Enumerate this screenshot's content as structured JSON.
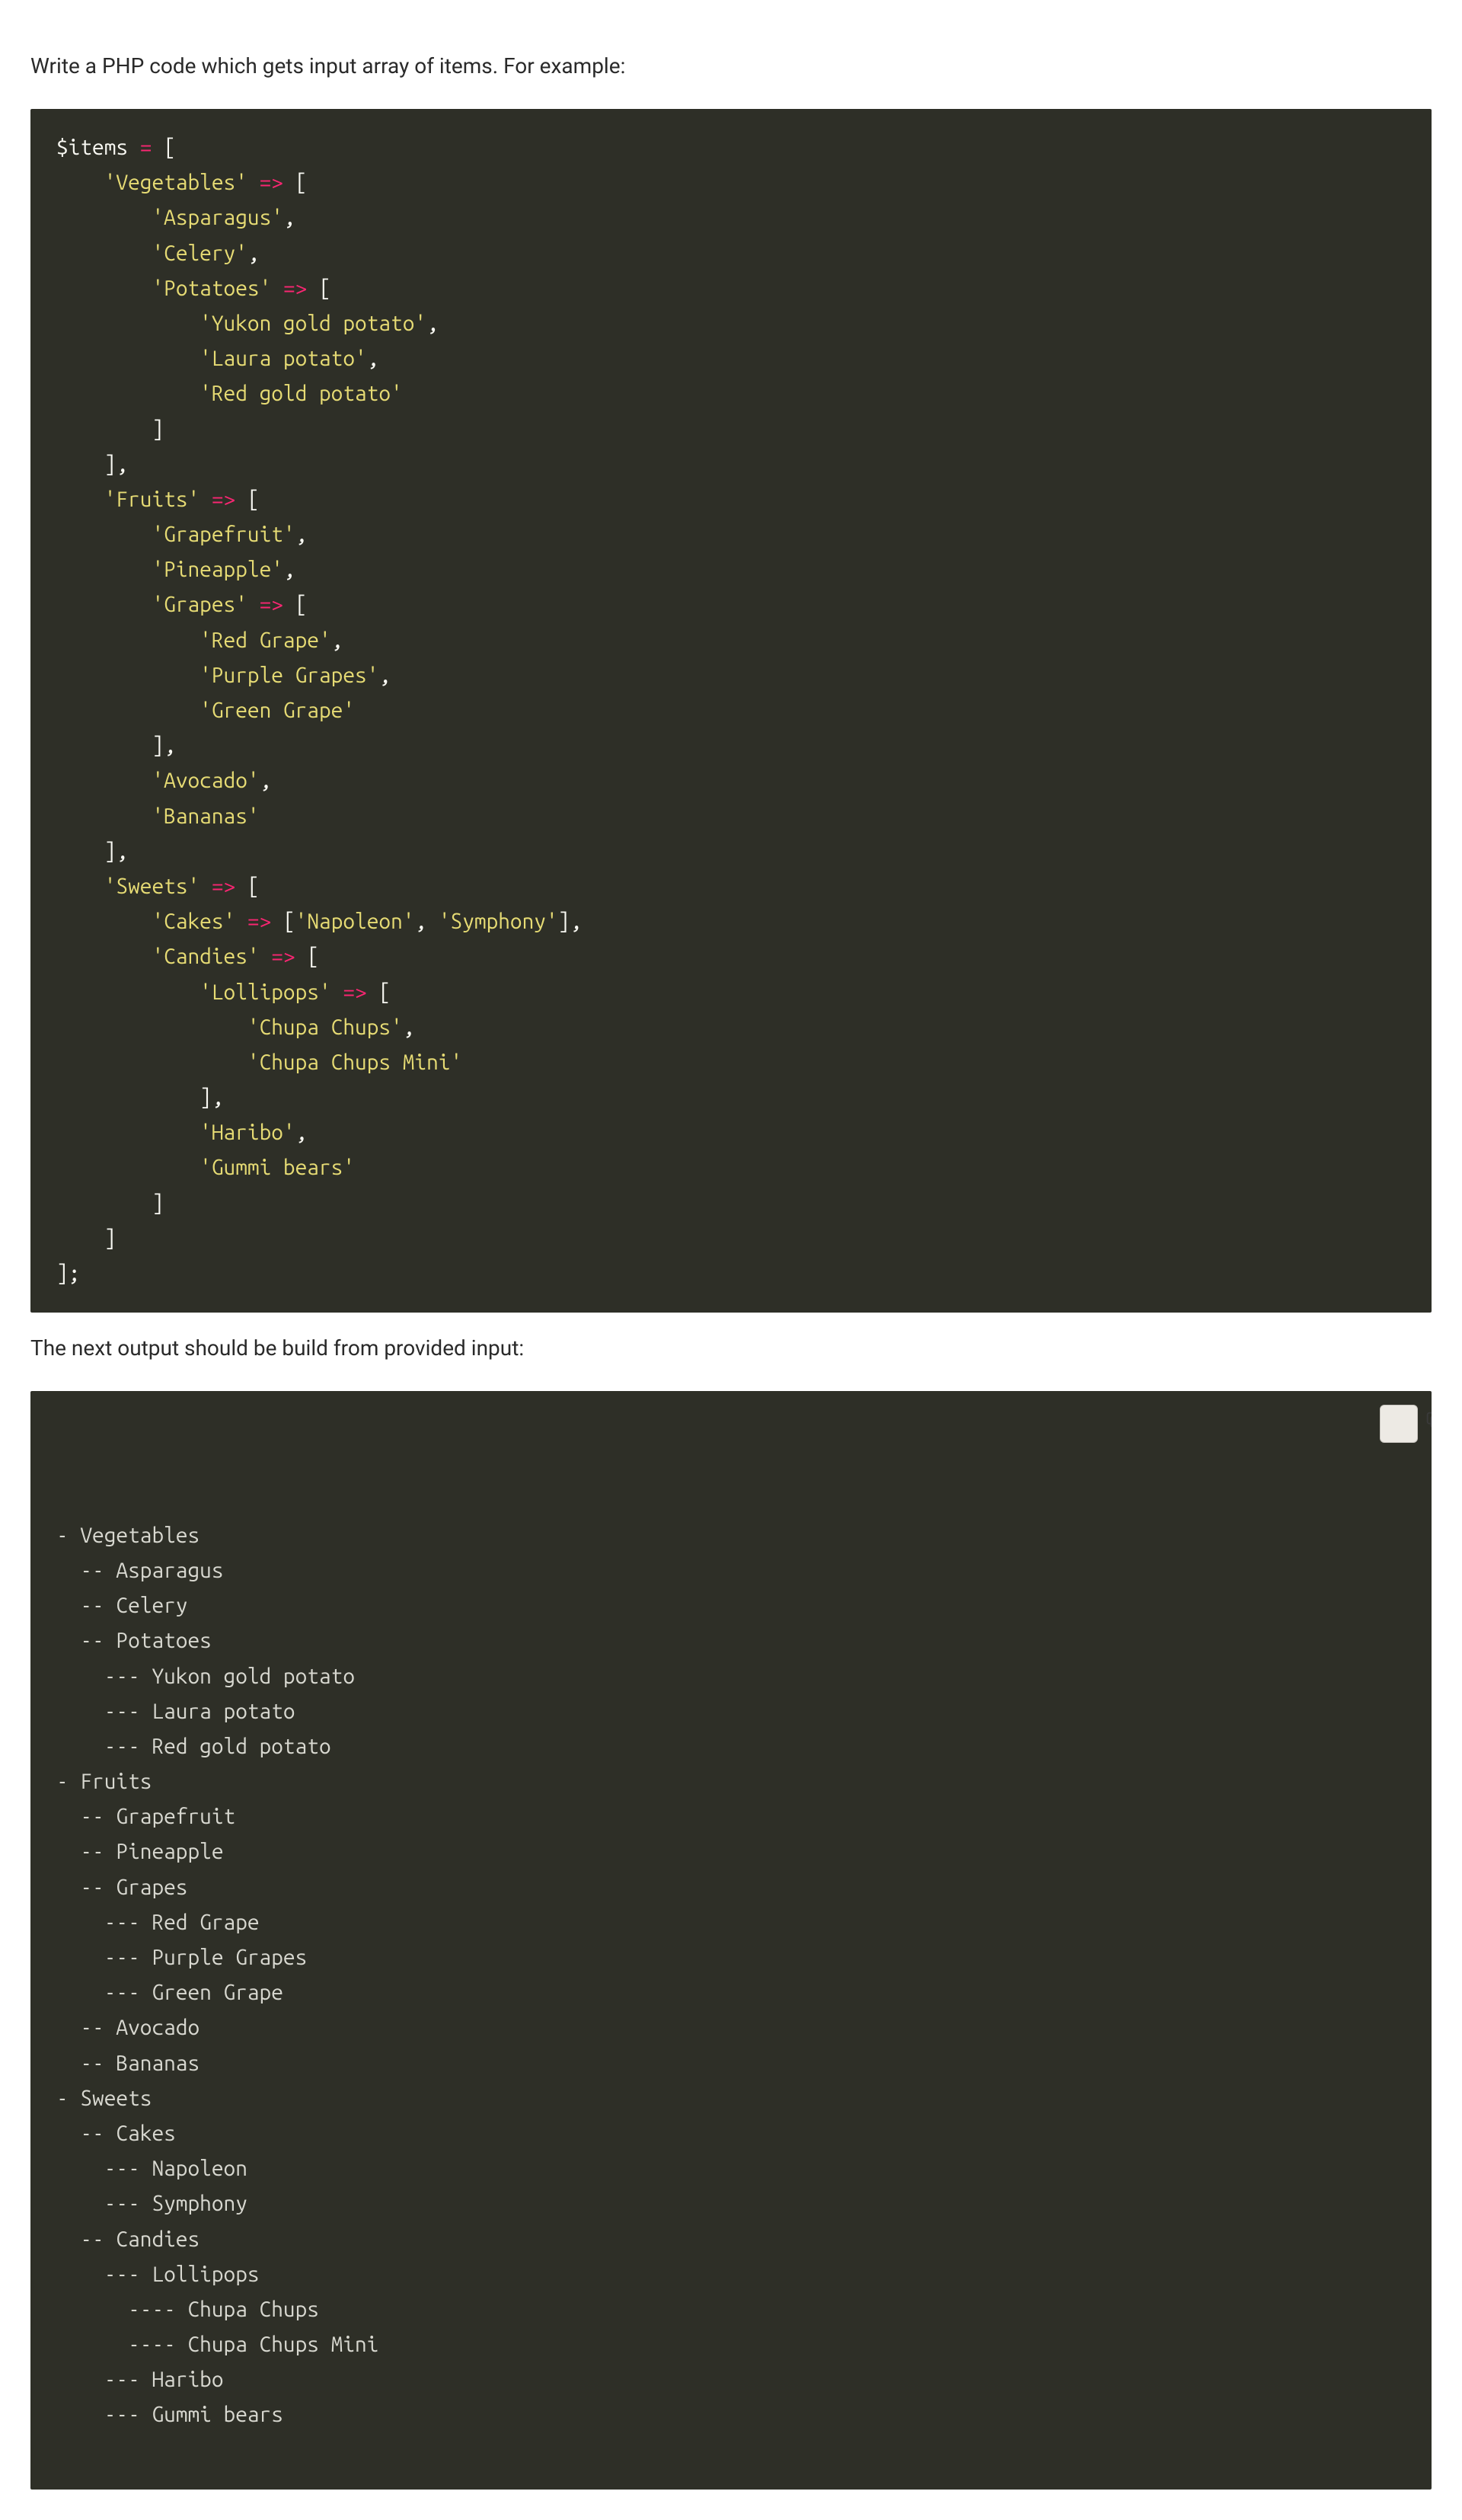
{
  "intro_text": "Write a PHP code which gets input array of items. For example:",
  "middle_text": "The next output should be build from provided input:",
  "php_code": {
    "var_name": "$items",
    "assign_op": "=",
    "arrow": "=>",
    "open_bracket": "[",
    "close_bracket": "]",
    "semicolon": ";",
    "comma": ",",
    "tree": [
      {
        "key": "Vegetables",
        "children": [
          {
            "value": "Asparagus"
          },
          {
            "value": "Celery"
          },
          {
            "key": "Potatoes",
            "children": [
              {
                "value": "Yukon gold potato"
              },
              {
                "value": "Laura potato"
              },
              {
                "value": "Red gold potato"
              }
            ]
          }
        ]
      },
      {
        "key": "Fruits",
        "children": [
          {
            "value": "Grapefruit"
          },
          {
            "value": "Pineapple"
          },
          {
            "key": "Grapes",
            "children": [
              {
                "value": "Red Grape"
              },
              {
                "value": "Purple Grapes"
              },
              {
                "value": "Green Grape"
              }
            ]
          },
          {
            "value": "Avocado"
          },
          {
            "value": "Bananas"
          }
        ]
      },
      {
        "key": "Sweets",
        "children": [
          {
            "key": "Cakes",
            "inline": true,
            "children": [
              {
                "value": "Napoleon"
              },
              {
                "value": "Symphony"
              }
            ]
          },
          {
            "key": "Candies",
            "children": [
              {
                "key": "Lollipops",
                "children": [
                  {
                    "value": "Chupa Chups"
                  },
                  {
                    "value": "Chupa Chups Mini"
                  }
                ]
              },
              {
                "value": "Haribo"
              },
              {
                "value": "Gummi bears"
              }
            ]
          }
        ]
      }
    ]
  },
  "output_block": {
    "dash": "-",
    "lines": [
      {
        "depth": 1,
        "text": "Vegetables"
      },
      {
        "depth": 2,
        "text": "Asparagus"
      },
      {
        "depth": 2,
        "text": "Celery"
      },
      {
        "depth": 2,
        "text": "Potatoes"
      },
      {
        "depth": 3,
        "text": "Yukon gold potato"
      },
      {
        "depth": 3,
        "text": "Laura potato"
      },
      {
        "depth": 3,
        "text": "Red gold potato"
      },
      {
        "depth": 1,
        "text": "Fruits"
      },
      {
        "depth": 2,
        "text": "Grapefruit"
      },
      {
        "depth": 2,
        "text": "Pineapple"
      },
      {
        "depth": 2,
        "text": "Grapes"
      },
      {
        "depth": 3,
        "text": "Red Grape"
      },
      {
        "depth": 3,
        "text": "Purple Grapes"
      },
      {
        "depth": 3,
        "text": "Green Grape"
      },
      {
        "depth": 2,
        "text": "Avocado"
      },
      {
        "depth": 2,
        "text": "Bananas"
      },
      {
        "depth": 1,
        "text": "Sweets"
      },
      {
        "depth": 2,
        "text": "Cakes"
      },
      {
        "depth": 3,
        "text": "Napoleon"
      },
      {
        "depth": 3,
        "text": "Symphony"
      },
      {
        "depth": 2,
        "text": "Candies"
      },
      {
        "depth": 3,
        "text": "Lollipops"
      },
      {
        "depth": 4,
        "text": "Chupa Chups"
      },
      {
        "depth": 4,
        "text": "Chupa Chups Mini"
      },
      {
        "depth": 3,
        "text": "Haribo"
      },
      {
        "depth": 3,
        "text": "Gummi bears"
      }
    ]
  }
}
